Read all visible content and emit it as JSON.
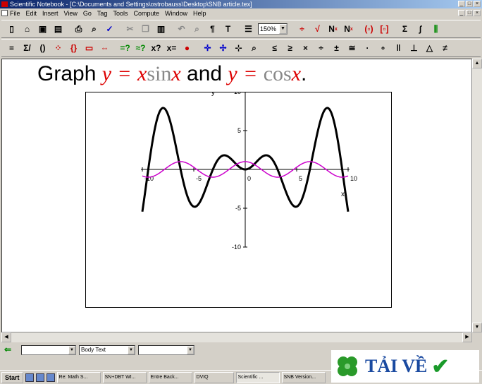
{
  "window": {
    "title": "Scientific Notebook - [C:\\Documents and Settings\\ostrobauss\\Desktop\\SNB article.tex]"
  },
  "menu": [
    "File",
    "Edit",
    "Insert",
    "View",
    "Go",
    "Tag",
    "Tools",
    "Compute",
    "Window",
    "Help"
  ],
  "toolbar": {
    "zoom_value": "150%"
  },
  "document": {
    "heading_word_graph": "Graph",
    "heading_var_y1": "y",
    "heading_eq1": "=",
    "heading_var_x1": "x",
    "heading_fn_sin": "sin",
    "heading_var_x2": "x",
    "heading_and": "and",
    "heading_var_y2": "y",
    "heading_eq2": "=",
    "heading_fn_cos": "cos",
    "heading_var_x3": "x",
    "heading_period": "."
  },
  "chart_data": {
    "type": "line",
    "title": "",
    "xlabel": "x",
    "ylabel": "y",
    "xlim": [
      -10,
      10
    ],
    "ylim": [
      -10,
      10
    ],
    "x_ticks": [
      -10,
      -5,
      0,
      5,
      10
    ],
    "y_ticks": [
      -10,
      -5,
      5,
      10
    ],
    "x_tick_labels": [
      "-10",
      "-5",
      "0",
      "5",
      "10"
    ],
    "y_tick_labels": [
      "-10",
      "-5",
      "5",
      "10"
    ],
    "grid": false,
    "series": [
      {
        "expression": "x sin x",
        "color": "#000000",
        "x": [
          -10,
          -9,
          -8,
          -7,
          -6,
          -5,
          -4,
          -3,
          -2,
          -1,
          0,
          1,
          2,
          3,
          4,
          5,
          6,
          7,
          8,
          9,
          10
        ],
        "y": [
          -5.44,
          3.71,
          7.91,
          4.6,
          -1.68,
          -4.79,
          -3.03,
          0.42,
          1.82,
          0.84,
          0,
          0.84,
          1.82,
          0.42,
          -3.03,
          -4.79,
          -1.68,
          4.6,
          7.91,
          3.71,
          -5.44
        ]
      },
      {
        "expression": "cos x",
        "color": "#cc00cc",
        "x": [
          -10,
          -9,
          -8,
          -7,
          -6,
          -5,
          -4,
          -3,
          -2,
          -1,
          0,
          1,
          2,
          3,
          4,
          5,
          6,
          7,
          8,
          9,
          10
        ],
        "y": [
          -0.84,
          -0.91,
          -0.15,
          0.75,
          0.96,
          0.28,
          -0.65,
          -0.99,
          -0.42,
          0.54,
          1,
          0.54,
          -0.42,
          -0.99,
          -0.65,
          0.28,
          0.96,
          0.75,
          -0.15,
          -0.91,
          -0.84
        ]
      }
    ]
  },
  "stylebar": {
    "section_value": "",
    "style_value": "Body Text",
    "font_value": ""
  },
  "taskbar": {
    "start_label": "Start",
    "tasks": [
      "Re: Math S...",
      "SN+DBT WI...",
      "Entre Back...",
      "DVIQ",
      "Scientific ...",
      "SNB Version..."
    ]
  },
  "watermark": {
    "text": "TẢI VỀ"
  },
  "colors": {
    "title_bar": "#0a246a",
    "heading_math": "#dd0000",
    "heading_function": "#888888",
    "series_1": "#000000",
    "series_2": "#cc00cc"
  }
}
